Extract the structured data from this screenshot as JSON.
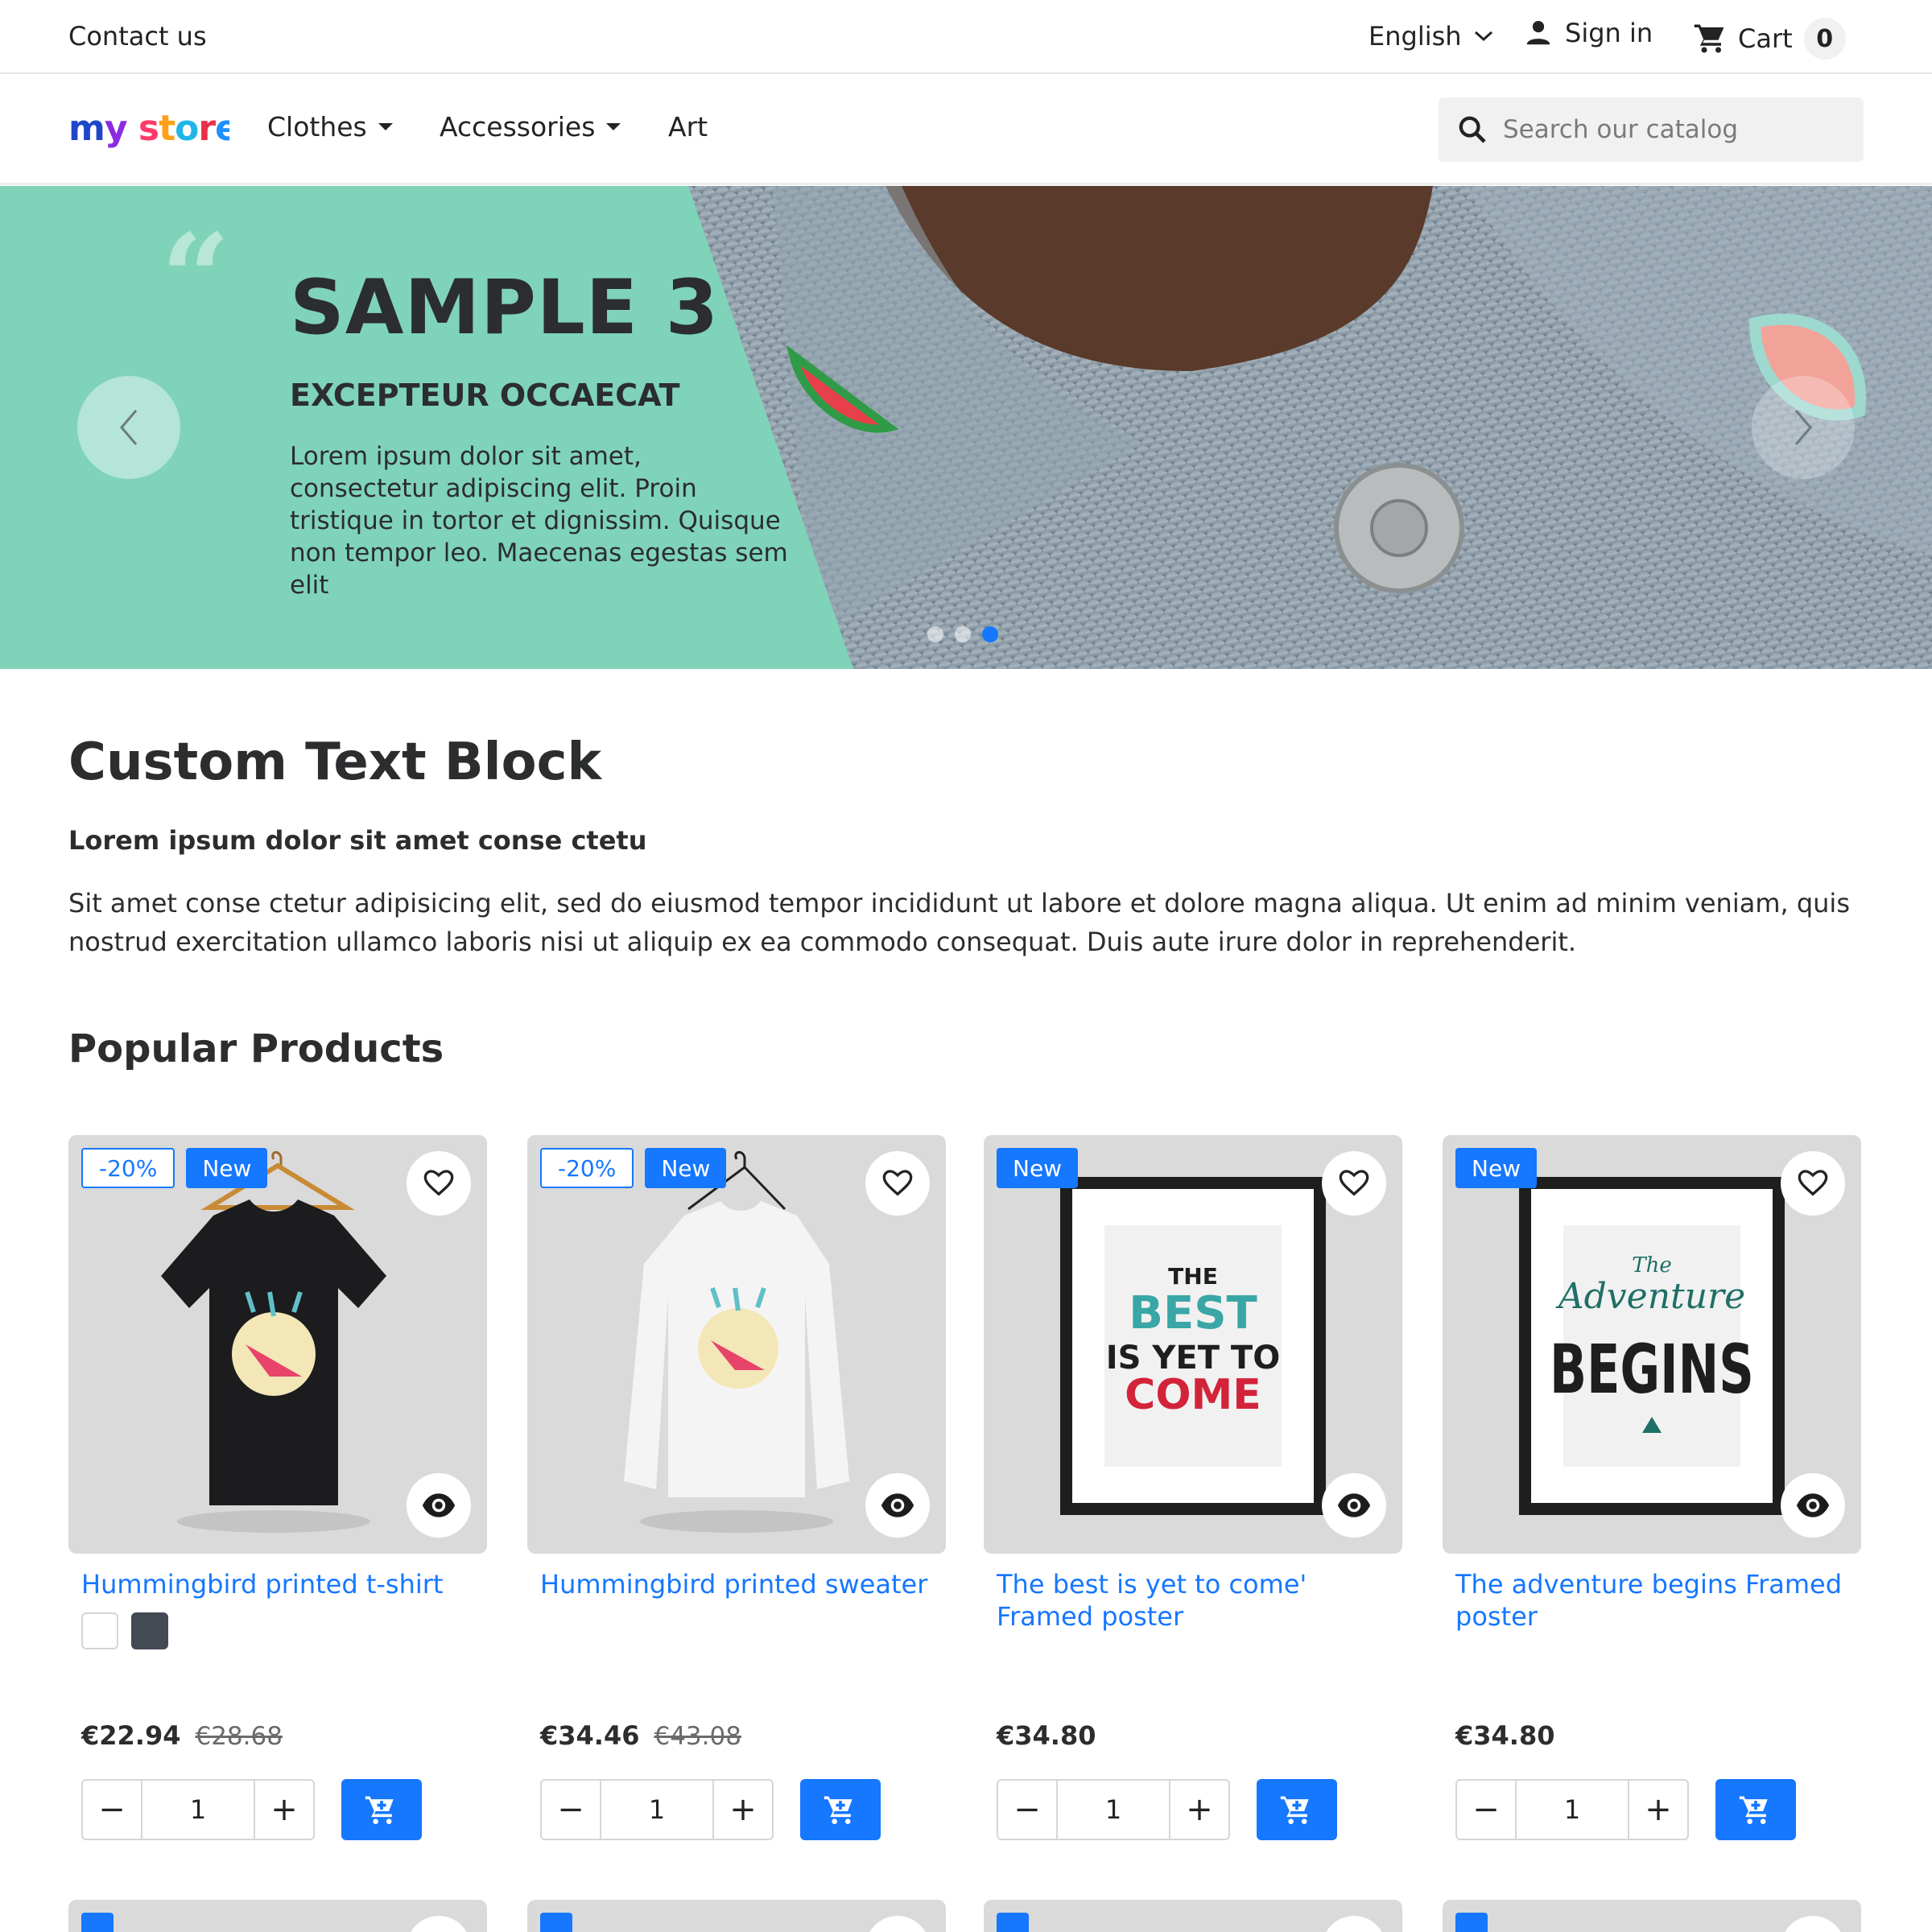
{
  "topbar": {
    "contact": "Contact us",
    "language": "English",
    "signin": "Sign in",
    "cart_label": "Cart",
    "cart_count": "0"
  },
  "header": {
    "logo_text": "my store",
    "nav": [
      {
        "label": "Clothes",
        "has_dropdown": true
      },
      {
        "label": "Accessories",
        "has_dropdown": true
      },
      {
        "label": "Art",
        "has_dropdown": false
      }
    ],
    "search_placeholder": "Search our catalog"
  },
  "hero": {
    "title": "SAMPLE 3",
    "subtitle": "EXCEPTEUR OCCAECAT",
    "text": "Lorem ipsum dolor sit amet, consectetur adipiscing elit. Proin tristique in tortor et dignissim. Quisque non tempor leo. Maecenas egestas sem elit",
    "slide_count": 3,
    "active_slide": 3,
    "accent_color": "#7fd3b9"
  },
  "text_block": {
    "title": "Custom Text Block",
    "subtitle": "Lorem ipsum dolor sit amet conse ctetu",
    "body": "Sit amet conse ctetur adipisicing elit, sed do eiusmod tempor incididunt ut labore et dolore magna aliqua. Ut enim ad minim veniam, quis nostrud exercitation ullamco laboris nisi ut aliquip ex ea commodo consequat. Duis aute irure dolor in reprehenderit."
  },
  "popular": {
    "title": "Popular Products",
    "products": [
      {
        "name": "Hummingbird printed t-shirt",
        "discount": "-20%",
        "flag": "New",
        "price": "€22.94",
        "old_price": "€28.68",
        "quantity": "1",
        "image": "black-tshirt",
        "swatches": [
          "#ffffff",
          "#434a54"
        ]
      },
      {
        "name": "Hummingbird printed sweater",
        "discount": "-20%",
        "flag": "New",
        "price": "€34.46",
        "old_price": "€43.08",
        "quantity": "1",
        "image": "white-sweater",
        "swatches": []
      },
      {
        "name": "The best is yet to come' Framed poster",
        "discount": "",
        "flag": "New",
        "price": "€34.80",
        "old_price": "",
        "quantity": "1",
        "image": "poster-best",
        "swatches": []
      },
      {
        "name": "The adventure begins Framed poster",
        "discount": "",
        "flag": "New",
        "price": "€34.80",
        "old_price": "",
        "quantity": "1",
        "image": "poster-adventure",
        "swatches": []
      }
    ]
  },
  "colors": {
    "primary": "#1677ff",
    "text": "#2b2d2f",
    "card_bg": "#dadada"
  }
}
